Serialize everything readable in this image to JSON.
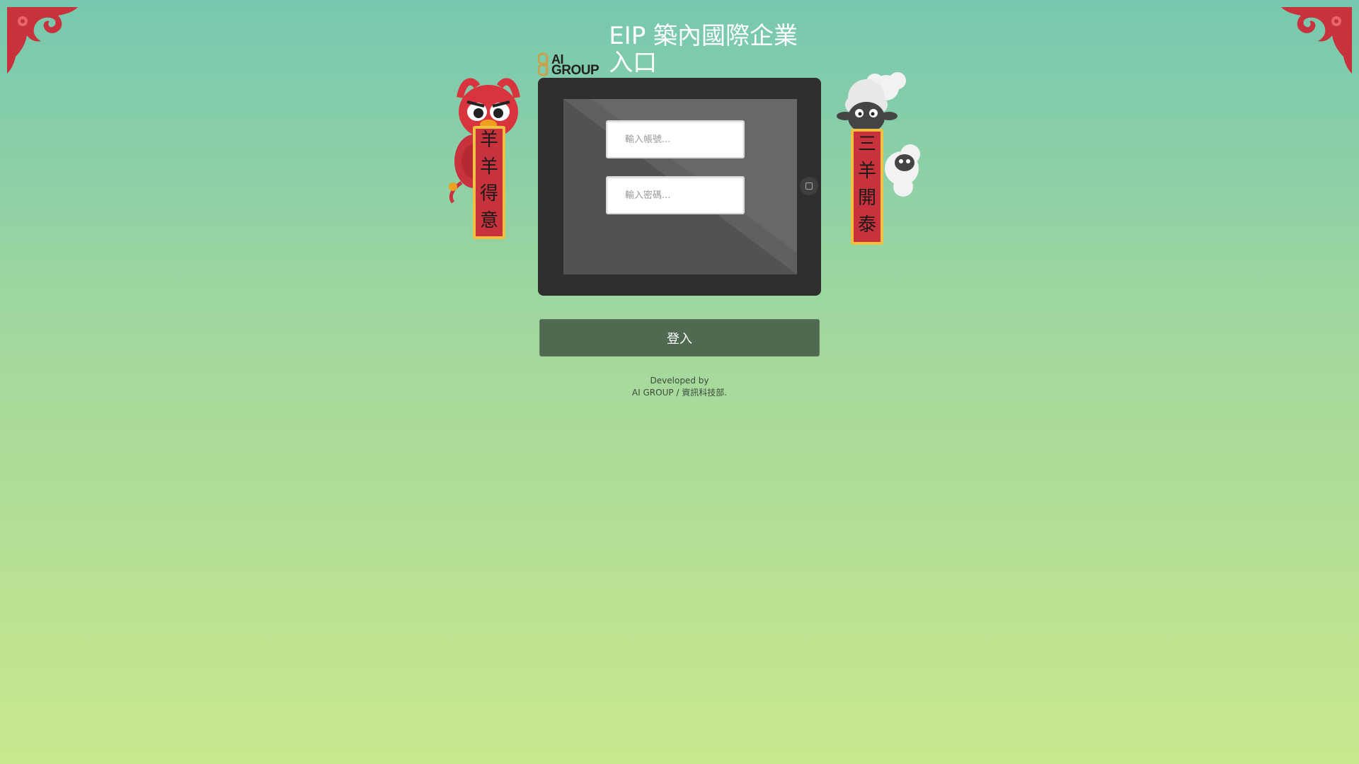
{
  "page": {
    "title": "EIP 築內國際企業入口",
    "background_gradient": [
      "#77c8b0",
      "#a3d89d",
      "#c8e88c"
    ]
  },
  "logo": {
    "line1": "AI",
    "line2": "GROUP",
    "mark_color": "#c8a24a"
  },
  "login_form": {
    "username_placeholder": "輸入帳號...",
    "password_placeholder": "輸入密碼...",
    "submit_label": "登入"
  },
  "mascots": {
    "left_banner": [
      "羊",
      "羊",
      "得",
      "意"
    ],
    "right_banner": [
      "三",
      "羊",
      "開",
      "泰"
    ],
    "banner_color": "#c8323c"
  },
  "footer": {
    "line1": "Developed by",
    "line2": "AI GROUP / 資訊科技部."
  },
  "colors": {
    "tablet_frame": "#2f2f2f",
    "tablet_screen": "#5a5c5d",
    "login_button": "#4f6a50",
    "corner_red": "#c8323c"
  }
}
